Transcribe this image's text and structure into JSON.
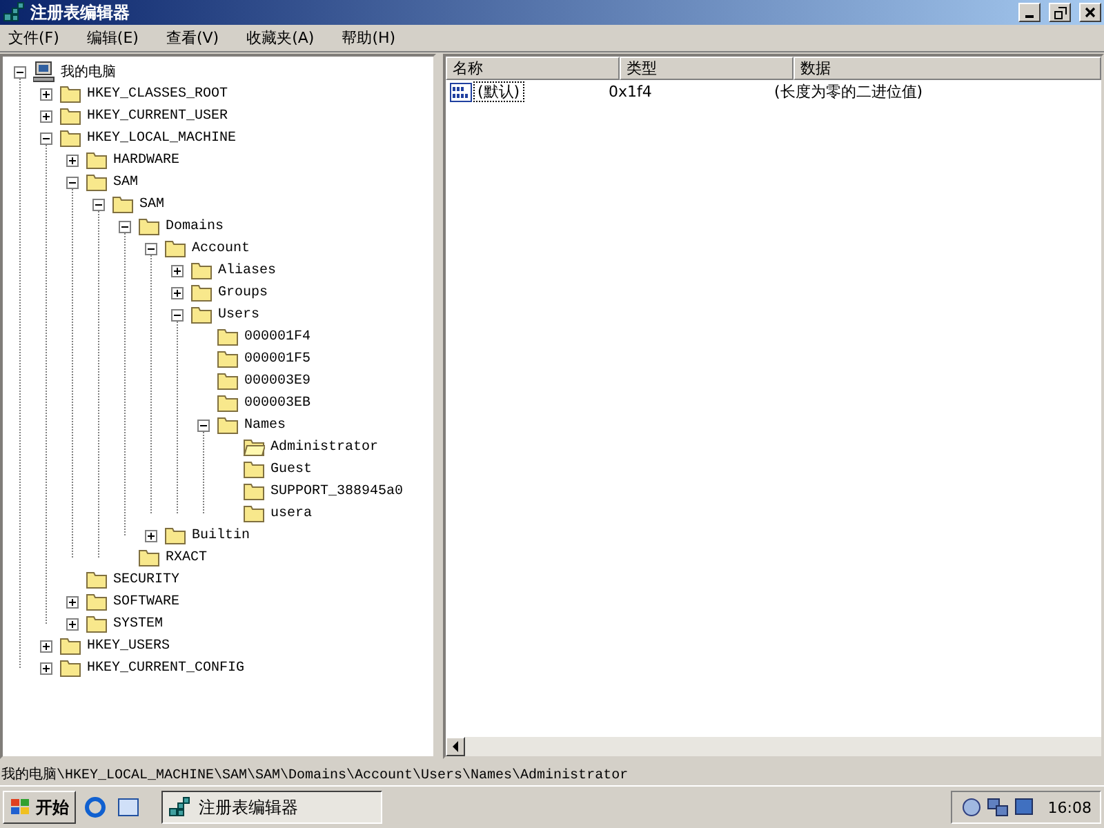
{
  "window": {
    "title": "注册表编辑器"
  },
  "menu": [
    {
      "label": "文件(F)"
    },
    {
      "label": "编辑(E)"
    },
    {
      "label": "查看(V)"
    },
    {
      "label": "收藏夹(A)"
    },
    {
      "label": "帮助(H)"
    }
  ],
  "tree": {
    "label": "我的电脑",
    "kind": "computer",
    "expanded": true,
    "selected": false,
    "children": [
      {
        "label": "HKEY_CLASSES_ROOT",
        "expanded": false,
        "selected": false
      },
      {
        "label": "HKEY_CURRENT_USER",
        "expanded": false,
        "selected": false
      },
      {
        "label": "HKEY_LOCAL_MACHINE",
        "expanded": true,
        "selected": false,
        "children": [
          {
            "label": "HARDWARE",
            "expanded": false,
            "selected": false
          },
          {
            "label": "SAM",
            "expanded": true,
            "selected": false,
            "children": [
              {
                "label": "SAM",
                "expanded": true,
                "selected": false,
                "children": [
                  {
                    "label": "Domains",
                    "expanded": true,
                    "selected": false,
                    "children": [
                      {
                        "label": "Account",
                        "expanded": true,
                        "selected": false,
                        "children": [
                          {
                            "label": "Aliases",
                            "expanded": false,
                            "selected": false
                          },
                          {
                            "label": "Groups",
                            "expanded": false,
                            "selected": false
                          },
                          {
                            "label": "Users",
                            "expanded": true,
                            "selected": false,
                            "children": [
                              {
                                "label": "000001F4",
                                "selected": false
                              },
                              {
                                "label": "000001F5",
                                "selected": false
                              },
                              {
                                "label": "000003E9",
                                "selected": false
                              },
                              {
                                "label": "000003EB",
                                "selected": false
                              },
                              {
                                "label": "Names",
                                "expanded": true,
                                "selected": false,
                                "children": [
                                  {
                                    "label": "Administrator",
                                    "selected": true
                                  },
                                  {
                                    "label": "Guest",
                                    "selected": false
                                  },
                                  {
                                    "label": "SUPPORT_388945a0",
                                    "selected": false
                                  },
                                  {
                                    "label": "usera",
                                    "selected": false
                                  }
                                ]
                              }
                            ]
                          }
                        ]
                      },
                      {
                        "label": "Builtin",
                        "expanded": false,
                        "selected": false
                      }
                    ]
                  },
                  {
                    "label": "RXACT",
                    "selected": false
                  }
                ]
              }
            ]
          },
          {
            "label": "SECURITY",
            "selected": false
          },
          {
            "label": "SOFTWARE",
            "expanded": false,
            "selected": false
          },
          {
            "label": "SYSTEM",
            "expanded": false,
            "selected": false
          }
        ]
      },
      {
        "label": "HKEY_USERS",
        "expanded": false,
        "selected": false
      },
      {
        "label": "HKEY_CURRENT_CONFIG",
        "expanded": false,
        "selected": false
      }
    ]
  },
  "list": {
    "columns": [
      "名称",
      "类型",
      "数据"
    ],
    "rows": [
      {
        "name": "(默认)",
        "type": "0x1f4",
        "data": "(长度为零的二进位值)",
        "focused": true
      }
    ]
  },
  "status_bar": "我的电脑\\HKEY_LOCAL_MACHINE\\SAM\\SAM\\Domains\\Account\\Users\\Names\\Administrator",
  "taskbar": {
    "start": "开始",
    "tasks": [
      {
        "label": "注册表编辑器",
        "selected": true
      }
    ],
    "clock": "16:08"
  }
}
